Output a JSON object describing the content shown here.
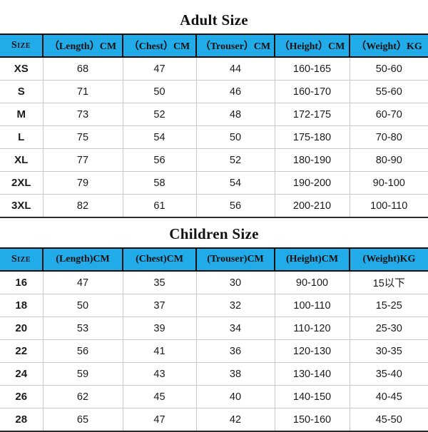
{
  "adult": {
    "title": "Adult Size",
    "columns": [
      "Size",
      "（Length）CM",
      "（Chest）CM",
      "（Trouser）CM",
      "（Height）CM",
      "（Weight）KG"
    ],
    "rows": [
      {
        "size": "XS",
        "length": "68",
        "chest": "47",
        "trouser": "44",
        "height": "160-165",
        "weight": "50-60"
      },
      {
        "size": "S",
        "length": "71",
        "chest": "50",
        "trouser": "46",
        "height": "160-170",
        "weight": "55-60"
      },
      {
        "size": "M",
        "length": "73",
        "chest": "52",
        "trouser": "48",
        "height": "172-175",
        "weight": "60-70"
      },
      {
        "size": "L",
        "length": "75",
        "chest": "54",
        "trouser": "50",
        "height": "175-180",
        "weight": "70-80"
      },
      {
        "size": "XL",
        "length": "77",
        "chest": "56",
        "trouser": "52",
        "height": "180-190",
        "weight": "80-90"
      },
      {
        "size": "2XL",
        "length": "79",
        "chest": "58",
        "trouser": "54",
        "height": "190-200",
        "weight": "90-100"
      },
      {
        "size": "3XL",
        "length": "82",
        "chest": "61",
        "trouser": "56",
        "height": "200-210",
        "weight": "100-110"
      }
    ]
  },
  "children": {
    "title": "Children Size",
    "columns": [
      "Size",
      "(Length)CM",
      "(Chest)CM",
      "(Trouser)CM",
      "(Height)CM",
      "(Weight)KG"
    ],
    "rows": [
      {
        "size": "16",
        "length": "47",
        "chest": "35",
        "trouser": "30",
        "height": "90-100",
        "weight": "15以下"
      },
      {
        "size": "18",
        "length": "50",
        "chest": "37",
        "trouser": "32",
        "height": "100-110",
        "weight": "15-25"
      },
      {
        "size": "20",
        "length": "53",
        "chest": "39",
        "trouser": "34",
        "height": "110-120",
        "weight": "25-30"
      },
      {
        "size": "22",
        "length": "56",
        "chest": "41",
        "trouser": "36",
        "height": "120-130",
        "weight": "30-35"
      },
      {
        "size": "24",
        "length": "59",
        "chest": "43",
        "trouser": "38",
        "height": "130-140",
        "weight": "35-40"
      },
      {
        "size": "26",
        "length": "62",
        "chest": "45",
        "trouser": "40",
        "height": "140-150",
        "weight": "40-45"
      },
      {
        "size": "28",
        "length": "65",
        "chest": "47",
        "trouser": "42",
        "height": "150-160",
        "weight": "45-50"
      }
    ]
  },
  "colors": {
    "header_blue": "#21abe8",
    "grid_line": "#c9c9c9",
    "border_dark": "#0f0f0f",
    "text": "#1b1b1b",
    "background": "#ffffff"
  }
}
